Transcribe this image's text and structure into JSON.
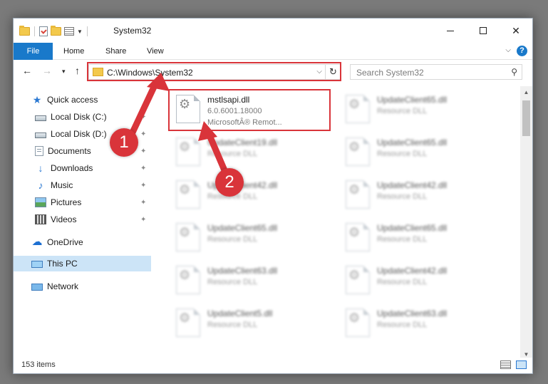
{
  "window": {
    "title": "System32",
    "caption": {
      "minimize": "",
      "maximize": "",
      "close": "✕"
    }
  },
  "ribbon": {
    "tabs": [
      "File",
      "Home",
      "Share",
      "View"
    ],
    "collapse_caret": "⌵",
    "help": "?"
  },
  "nav": {
    "back": "←",
    "forward": "→",
    "recent": "▾",
    "up": "↑",
    "address": "C:\\Windows\\System32",
    "address_caret": "⌵",
    "refresh": "↻",
    "search_placeholder": "Search System32",
    "search_glass": "⚲"
  },
  "sidebar": {
    "items": [
      {
        "label": "Quick access",
        "icon": "star-icon",
        "pinned": false
      },
      {
        "label": "Local Disk (C:)",
        "icon": "drive-icon",
        "pinned": true
      },
      {
        "label": "Local Disk (D:)",
        "icon": "drive-icon",
        "pinned": true
      },
      {
        "label": "Documents",
        "icon": "documents-icon",
        "pinned": true
      },
      {
        "label": "Downloads",
        "icon": "download-icon",
        "pinned": true
      },
      {
        "label": "Music",
        "icon": "music-icon",
        "pinned": true
      },
      {
        "label": "Pictures",
        "icon": "pictures-icon",
        "pinned": true
      },
      {
        "label": "Videos",
        "icon": "videos-icon",
        "pinned": true
      },
      {
        "label": "OneDrive",
        "icon": "onedrive-icon",
        "pinned": false
      },
      {
        "label": "This PC",
        "icon": "this-pc-icon",
        "pinned": false,
        "selected": true
      },
      {
        "label": "Network",
        "icon": "network-icon",
        "pinned": false
      }
    ],
    "pin_glyph": "✦"
  },
  "files": {
    "highlighted": {
      "name": "mstlsapi.dll",
      "version": "6.0.6001.18000",
      "company": "MicrosoftÂ® Remot..."
    },
    "left_column": [
      {
        "name": "UpdateClient19.dll",
        "type": "Resource DLL"
      },
      {
        "name": "UpdateClient42.dll",
        "type": "Resource DLL"
      },
      {
        "name": "UpdateClient65.dll",
        "type": "Resource DLL"
      },
      {
        "name": "UpdateClient63.dll",
        "type": "Resource DLL"
      },
      {
        "name": "UpdateClient5.dll",
        "type": "Resource DLL"
      }
    ],
    "right_column": [
      {
        "name": "UpdateClient65.dll",
        "type": "Resource DLL"
      },
      {
        "name": "UpdateClient65.dll",
        "type": "Resource DLL"
      },
      {
        "name": "UpdateClient42.dll",
        "type": "Resource DLL"
      },
      {
        "name": "UpdateClient65.dll",
        "type": "Resource DLL"
      },
      {
        "name": "UpdateClient42.dll",
        "type": "Resource DLL"
      },
      {
        "name": "UpdateClient63.dll",
        "type": "Resource DLL"
      }
    ]
  },
  "status": {
    "item_count": "153 items"
  },
  "annotations": {
    "callout_1": "1",
    "callout_2": "2",
    "color": "#d9343a"
  }
}
